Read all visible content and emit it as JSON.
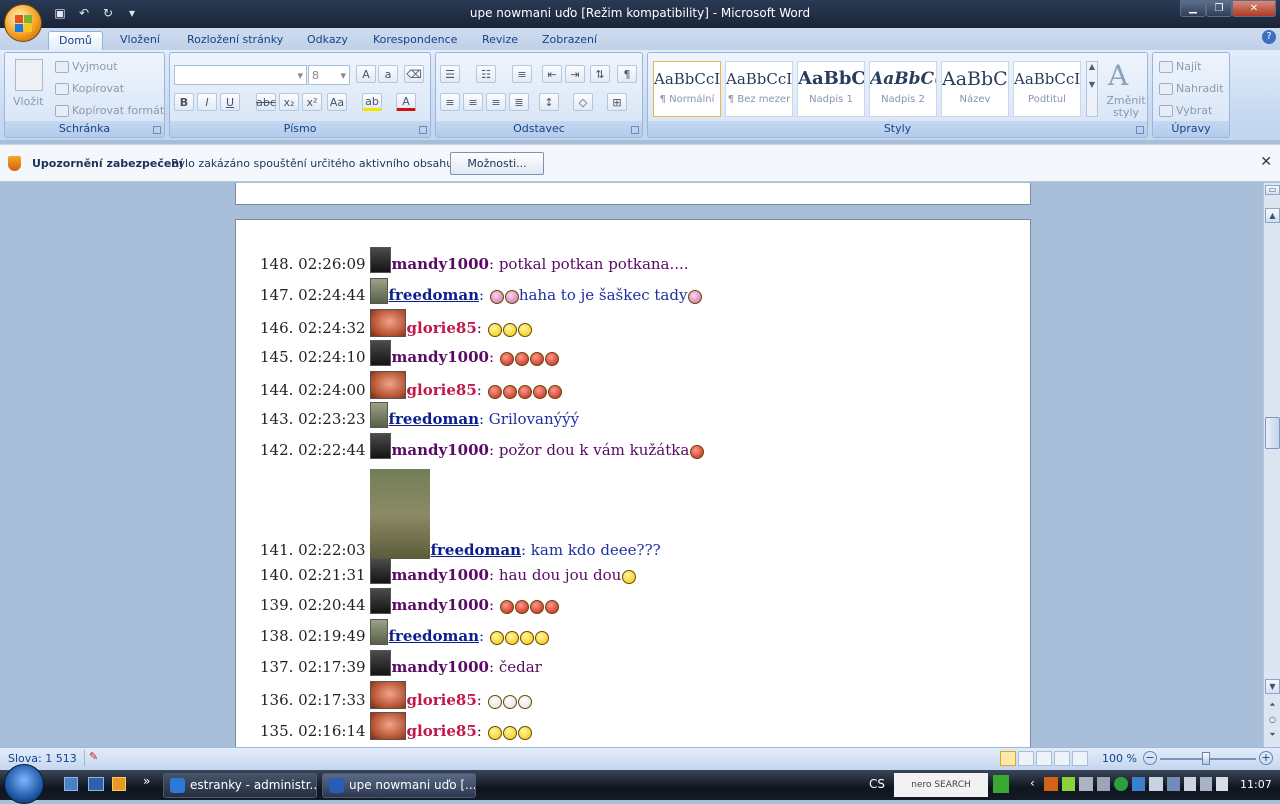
{
  "window": {
    "title": "upe nowmani uďo [Režim kompatibility] - Microsoft Word"
  },
  "ribbon_tabs": [
    {
      "label": "Domů"
    },
    {
      "label": "Vložení"
    },
    {
      "label": "Rozložení stránky"
    },
    {
      "label": "Odkazy"
    },
    {
      "label": "Korespondence"
    },
    {
      "label": "Revize"
    },
    {
      "label": "Zobrazení"
    }
  ],
  "clipboard": {
    "paste": "Vložit",
    "cut": "Vyjmout",
    "copy": "Kopírovat",
    "format_painter": "Kopírovat formát",
    "label": "Schránka"
  },
  "font": {
    "size": "8",
    "label": "Písmo"
  },
  "paragraph": {
    "label": "Odstavec"
  },
  "styles": {
    "label": "Styly",
    "change": "Změnit styly",
    "items": [
      {
        "sample": "AaBbCcI",
        "name": "¶ Normální"
      },
      {
        "sample": "AaBbCcI",
        "name": "¶ Bez mezer"
      },
      {
        "sample": "AaBbC(",
        "name": "Nadpis 1"
      },
      {
        "sample": "AaBbC(",
        "name": "Nadpis 2"
      },
      {
        "sample": "AaBbC(",
        "name": "Název"
      },
      {
        "sample": "AaBbCcI",
        "name": "Podtitul"
      }
    ]
  },
  "editing": {
    "find": "Najít",
    "replace": "Nahradit",
    "select": "Vybrat",
    "label": "Úpravy"
  },
  "security_bar": {
    "title": "Upozornění zabezpečení",
    "message": "Bylo zakázáno spouštění určitého aktivního obsahu.",
    "options_button": "Možnosti..."
  },
  "chat": [
    {
      "stamp": "148. 02:26:09",
      "user": "mandy1000",
      "text": ": potkal potkan potkana....",
      "smileys": []
    },
    {
      "stamp": "147. 02:24:44",
      "user": "freedoman",
      "text": ": ",
      "smileys": [
        "pink",
        "pink"
      ],
      "text2": "haha to je šaškec tady",
      "smileys2": [
        "pink"
      ]
    },
    {
      "stamp": "146. 02:24:32",
      "user": "glorie85",
      "text": ": ",
      "smileys": [
        "yellow",
        "yellow",
        "yellow"
      ]
    },
    {
      "stamp": "145. 02:24:10",
      "user": "mandy1000",
      "text": ": ",
      "smileys": [
        "red",
        "red",
        "red",
        "red"
      ]
    },
    {
      "stamp": "144. 02:24:00",
      "user": "glorie85",
      "text": ": ",
      "smileys": [
        "red",
        "red",
        "red",
        "red",
        "red"
      ]
    },
    {
      "stamp": "143. 02:23:23",
      "user": "freedoman",
      "text": ": Grilovanýýý",
      "smileys": []
    },
    {
      "stamp": "142. 02:22:44",
      "user": "mandy1000",
      "text": ": požor dou k vám kužátka",
      "smileys": [
        "red"
      ]
    },
    {
      "stamp": "141. 02:22:03",
      "user": "freedoman",
      "text": ": kam kdo deee???",
      "smileys": [],
      "big_avatar": true
    },
    {
      "stamp": "140. 02:21:31",
      "user": "mandy1000",
      "text": ": hau dou jou dou",
      "smileys": [
        "yellow"
      ]
    },
    {
      "stamp": "139. 02:20:44",
      "user": "mandy1000",
      "text": ": ",
      "smileys": [
        "red",
        "red",
        "red",
        "red"
      ]
    },
    {
      "stamp": "138. 02:19:49",
      "user": "freedoman",
      "text": ": ",
      "smileys": [
        "yellow",
        "yellow",
        "yellow",
        "yellow"
      ]
    },
    {
      "stamp": "137. 02:17:39",
      "user": "mandy1000",
      "text": ": čedar",
      "smileys": []
    },
    {
      "stamp": "136. 02:17:33",
      "user": "glorie85",
      "text": ": ",
      "smileys": [
        "white",
        "white",
        "white"
      ]
    },
    {
      "stamp": "135. 02:16:14",
      "user": "glorie85",
      "text": ": ",
      "smileys": [
        "yellow",
        "yellow",
        "yellow"
      ]
    }
  ],
  "status": {
    "words": "Slova: 1 513",
    "zoom": "100 %"
  },
  "taskbar": {
    "items": [
      {
        "label": "estranky - administr..."
      },
      {
        "label": "upe nowmani uďo [..."
      }
    ],
    "lang": "CS",
    "search": "nero SEARCH",
    "clock": "11:07"
  },
  "colors": {
    "mandy": "#5a0a66",
    "freedoman": "#0b1f8c",
    "glorie": "#c2184a"
  }
}
